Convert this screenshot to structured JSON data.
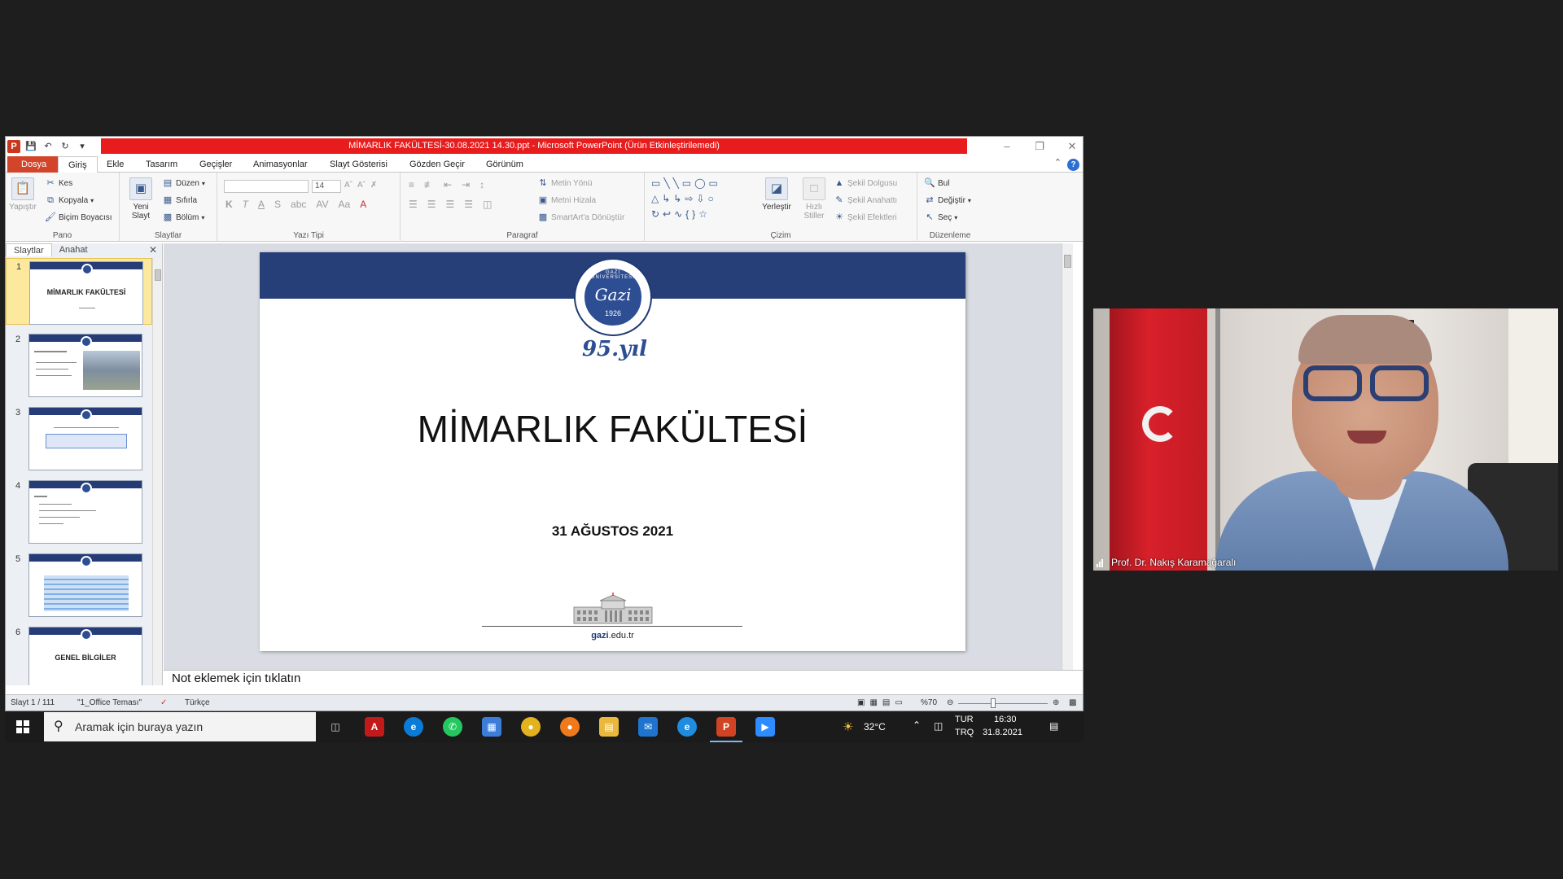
{
  "window": {
    "title": "MİMARLIK FAKÜLTESİ-30.08.2021 14.30.ppt  -  Microsoft PowerPoint (Ürün Etkinleştirilemedi)"
  },
  "tabs": [
    "Dosya",
    "Giriş",
    "Ekle",
    "Tasarım",
    "Geçişler",
    "Animasyonlar",
    "Slayt Gösterisi",
    "Gözden Geçir",
    "Görünüm"
  ],
  "ribbon": {
    "clipboard": {
      "label": "Pano",
      "paste": "Yapıştır",
      "cut": "Kes",
      "copy": "Kopyala",
      "format_painter": "Biçim Boyacısı"
    },
    "slides": {
      "label": "Slaytlar",
      "new_slide_1": "Yeni",
      "new_slide_2": "Slayt",
      "layout": "Düzen",
      "reset": "Sıfırla",
      "section": "Bölüm"
    },
    "font": {
      "label": "Yazı Tipi",
      "font_name": "",
      "font_size": "14"
    },
    "paragraph": {
      "label": "Paragraf",
      "text_direction": "Metin Yönü",
      "align_text": "Metni Hizala",
      "smartart": "SmartArt'a Dönüştür"
    },
    "drawing": {
      "label": "Çizim",
      "arrange": "Yerleştir",
      "quick_styles_1": "Hızlı",
      "quick_styles_2": "Stiller",
      "shape_fill": "Şekil Dolgusu",
      "shape_outline": "Şekil Anahattı",
      "shape_effects": "Şekil Efektleri"
    },
    "editing": {
      "label": "Düzenleme",
      "find": "Bul",
      "replace": "Değiştir",
      "select": "Seç"
    }
  },
  "panel": {
    "tab_slides": "Slaytlar",
    "tab_outline": "Anahat",
    "thumbnails": [
      {
        "num": "1",
        "title": "MİMARLIK FAKÜLTESİ"
      },
      {
        "num": "2",
        "title": ""
      },
      {
        "num": "3",
        "title": ""
      },
      {
        "num": "4",
        "title": ""
      },
      {
        "num": "5",
        "title": ""
      },
      {
        "num": "6",
        "title": "GENEL BİLGİLER"
      }
    ]
  },
  "slide": {
    "seal_name": "GAZİ ÜNİVERSİTESİ",
    "seal_script": "Gazi",
    "seal_year": "1926",
    "anniversary": "95.yıl",
    "title": "MİMARLIK FAKÜLTESİ",
    "date": "31 AĞUSTOS 2021",
    "url_bold": "gazi",
    "url_rest": ".edu.tr"
  },
  "notes": {
    "placeholder": "Not eklemek için tıklatın"
  },
  "status": {
    "slide_count": "Slayt 1 / 111",
    "theme": "\"1_Office Teması\"",
    "language": "Türkçe",
    "zoom": "%70"
  },
  "taskbar": {
    "search_placeholder": "Aramak için buraya yazın",
    "weather": "32°C",
    "lang_1": "TUR",
    "lang_2": "TRQ",
    "time": "16:30",
    "date": "31.8.2021"
  },
  "video": {
    "participant": "Prof. Dr. Nakış Karamağaralı"
  },
  "colors": {
    "title_bar": "#e81c1c",
    "file_tab": "#d2452a",
    "slide_band": "#263f79",
    "taskbar": "#1b1b1b"
  }
}
